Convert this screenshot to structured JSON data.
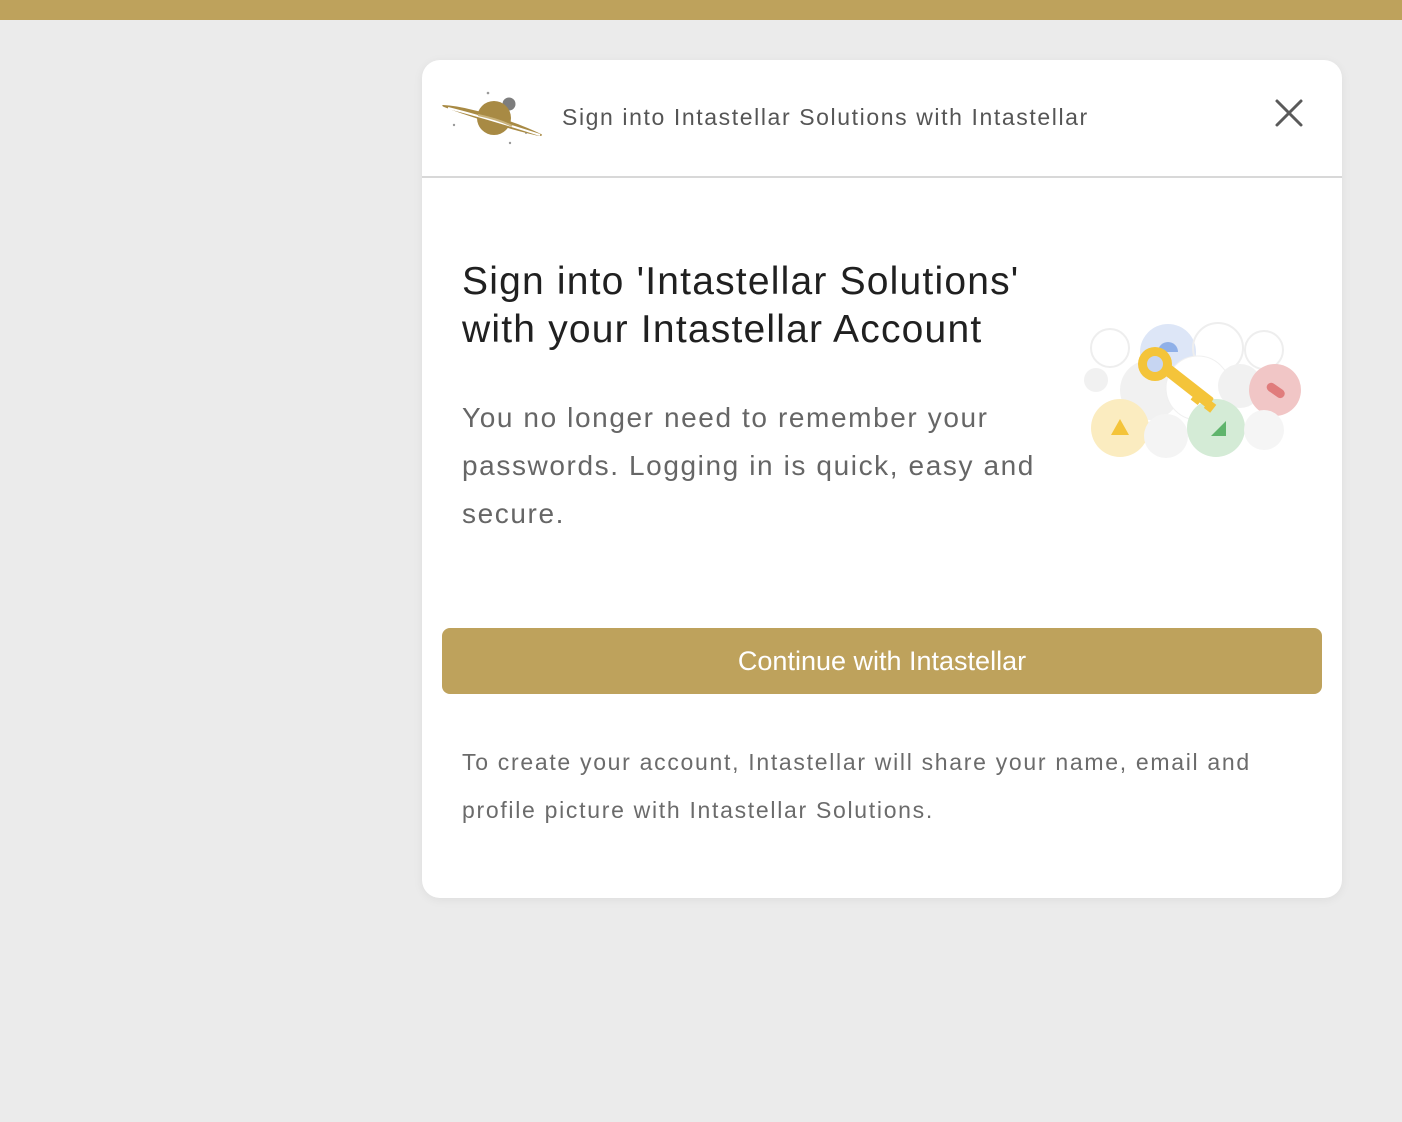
{
  "theme": {
    "accent": "#bea25c",
    "page_background": "#ebebeb",
    "dialog_background": "#ffffff"
  },
  "header": {
    "logo_icon": "planet-logo-icon",
    "title": "Sign into Intastellar Solutions with Intastellar",
    "close_icon": "close-icon"
  },
  "main": {
    "heading": "Sign into 'Intastellar Solutions' with your Intastellar Account",
    "description": "You no longer need to remember your passwords. Logging in is quick, easy and secure.",
    "illustration_icon": "key-illustration-icon",
    "continue_label": "Continue with Intastellar",
    "footer_note": "To create your account, Intastellar will share your name, email and profile picture with Intastellar Solutions."
  }
}
